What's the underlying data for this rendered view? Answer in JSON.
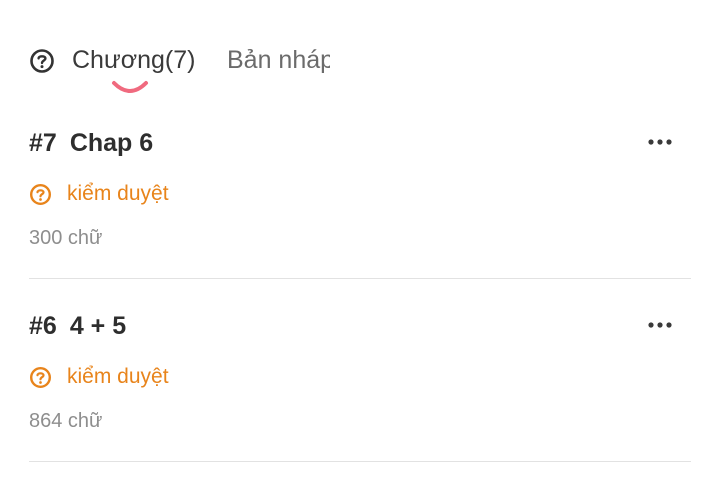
{
  "tabs": [
    {
      "label": "Chương(7)",
      "active": true
    },
    {
      "label": "Bản nháp",
      "active": false
    }
  ],
  "icons": {
    "help": "question-circle-icon",
    "status": "question-circle-icon",
    "more": "more-horizontal-icon"
  },
  "colors": {
    "accent_indicator": "#f06a7f",
    "status": "#e8841b",
    "title": "#2e2e2e",
    "meta": "#8e8e8e"
  },
  "chapters": [
    {
      "number": "#7",
      "title": "Chap 6",
      "status": "kiểm duyệt",
      "word_count": "300 chữ"
    },
    {
      "number": "#6",
      "title": "4 + 5",
      "status": "kiểm duyệt",
      "word_count": "864 chữ"
    }
  ]
}
